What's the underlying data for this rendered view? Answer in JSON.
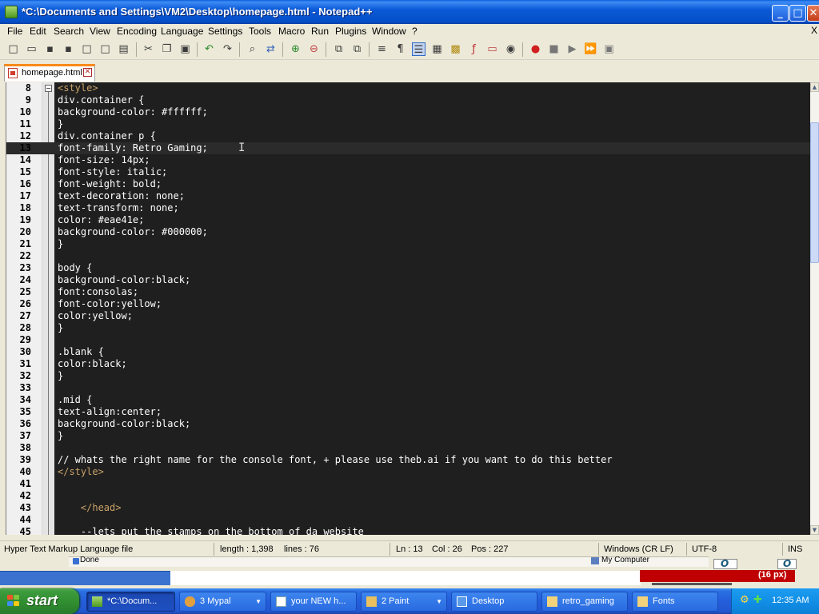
{
  "window": {
    "title": "*C:\\Documents and Settings\\VM2\\Desktop\\homepage.html - Notepad++",
    "min_glyph": "_",
    "max_glyph": "□",
    "close_glyph": "✕"
  },
  "menu": {
    "items": [
      "File",
      "Edit",
      "Search",
      "View",
      "Encoding",
      "Language",
      "Settings",
      "Tools",
      "Macro",
      "Run",
      "Plugins",
      "Window",
      "?"
    ],
    "close_x": "X"
  },
  "toolbar": {
    "icons": [
      "new-file-icon",
      "open-file-icon",
      "save-icon",
      "save-all-icon",
      "close-icon",
      "close-all-icon",
      "print-icon",
      "cut-icon",
      "copy-icon",
      "paste-icon",
      "undo-icon",
      "redo-icon",
      "find-icon",
      "replace-icon",
      "zoom-in-icon",
      "zoom-out-icon",
      "sync-vertical-icon",
      "sync-horizontal-icon",
      "word-wrap-icon",
      "show-all-chars-icon",
      "indent-guide-icon",
      "udl-icon",
      "doc-map-icon",
      "function-list-icon",
      "folder-workspace-icon",
      "monitoring-icon",
      "record-macro-icon",
      "stop-macro-icon",
      "play-macro-icon",
      "run-macro-multiple-icon",
      "save-macro-icon"
    ]
  },
  "tab": {
    "label": "homepage.html",
    "close_glyph": "✕"
  },
  "editor": {
    "current_line": 13,
    "lines": [
      {
        "n": "8",
        "text": "<style>",
        "kind": "tag"
      },
      {
        "n": "9",
        "text": "div.container {",
        "kind": "code"
      },
      {
        "n": "10",
        "text": "background-color: #ffffff;",
        "kind": "code"
      },
      {
        "n": "11",
        "text": "}",
        "kind": "code"
      },
      {
        "n": "12",
        "text": "div.container p {",
        "kind": "code"
      },
      {
        "n": "13",
        "text": "font-family: Retro Gaming;",
        "kind": "code"
      },
      {
        "n": "14",
        "text": "font-size: 14px;",
        "kind": "code"
      },
      {
        "n": "15",
        "text": "font-style: italic;",
        "kind": "code"
      },
      {
        "n": "16",
        "text": "font-weight: bold;",
        "kind": "code"
      },
      {
        "n": "17",
        "text": "text-decoration: none;",
        "kind": "code"
      },
      {
        "n": "18",
        "text": "text-transform: none;",
        "kind": "code"
      },
      {
        "n": "19",
        "text": "color: #eae41e;",
        "kind": "code"
      },
      {
        "n": "20",
        "text": "background-color: #000000;",
        "kind": "code"
      },
      {
        "n": "21",
        "text": "}",
        "kind": "code"
      },
      {
        "n": "22",
        "text": "",
        "kind": "code"
      },
      {
        "n": "23",
        "text": "body {",
        "kind": "code"
      },
      {
        "n": "24",
        "text": "background-color:black;",
        "kind": "code"
      },
      {
        "n": "25",
        "text": "font:consolas;",
        "kind": "code"
      },
      {
        "n": "26",
        "text": "font-color:yellow;",
        "kind": "code"
      },
      {
        "n": "27",
        "text": "color:yellow;",
        "kind": "code"
      },
      {
        "n": "28",
        "text": "}",
        "kind": "code"
      },
      {
        "n": "29",
        "text": "",
        "kind": "code"
      },
      {
        "n": "30",
        "text": ".blank {",
        "kind": "code"
      },
      {
        "n": "31",
        "text": "color:black;",
        "kind": "code"
      },
      {
        "n": "32",
        "text": "}",
        "kind": "code"
      },
      {
        "n": "33",
        "text": "",
        "kind": "code"
      },
      {
        "n": "34",
        "text": ".mid {",
        "kind": "code"
      },
      {
        "n": "35",
        "text": "text-align:center;",
        "kind": "code"
      },
      {
        "n": "36",
        "text": "background-color:black;",
        "kind": "code"
      },
      {
        "n": "37",
        "text": "}",
        "kind": "code"
      },
      {
        "n": "38",
        "text": "",
        "kind": "code"
      },
      {
        "n": "39",
        "text": "// whats the right name for the console font, + please use theb.ai if you want to do this better",
        "kind": "code"
      },
      {
        "n": "40",
        "text": "</style>",
        "kind": "tag"
      },
      {
        "n": "41",
        "text": "",
        "kind": "code"
      },
      {
        "n": "42",
        "text": "",
        "kind": "code"
      },
      {
        "n": "43",
        "text": "    </head>",
        "kind": "tag"
      },
      {
        "n": "44",
        "text": "",
        "kind": "code"
      },
      {
        "n": "45",
        "text": "    --lets put the stamps on the bottom of da website",
        "kind": "code"
      }
    ]
  },
  "status": {
    "file_type": "Hyper Text Markup Language file",
    "length": "length : 1,398",
    "lines": "lines : 76",
    "ln": "Ln : 13",
    "col": "Col : 26",
    "pos": "Pos : 227",
    "eol": "Windows (CR LF)",
    "encoding": "UTF-8",
    "mode": "INS"
  },
  "background": {
    "ie_status": "Done",
    "zone": "My Computer",
    "size_label": "(16 px)"
  },
  "taskbar": {
    "start_label": "start",
    "tasks": [
      {
        "label": "*C:\\Docum...",
        "icon": "notepad-plus-icon",
        "arrow": ""
      },
      {
        "label": "3 Mypal",
        "icon": "mypal-icon",
        "arrow": "▼"
      },
      {
        "label": "your NEW h...",
        "icon": "browser-window-icon",
        "arrow": ""
      },
      {
        "label": "2 Paint",
        "icon": "paint-icon",
        "arrow": "▼"
      },
      {
        "label": "Desktop",
        "icon": "desktop-icon",
        "arrow": ""
      },
      {
        "label": "retro_gaming",
        "icon": "folder-icon",
        "arrow": ""
      },
      {
        "label": "Fonts",
        "icon": "folder-icon",
        "arrow": ""
      }
    ],
    "clock": "12:35 AM"
  },
  "colors": {
    "editor_bg": "#1f1f1f",
    "code_text": "#ffffff",
    "tag_text": "#c9a26a",
    "tab_accent": "#fa8a1a",
    "start_green": "#3c9a3c",
    "taskbar_blue": "#245edb"
  }
}
